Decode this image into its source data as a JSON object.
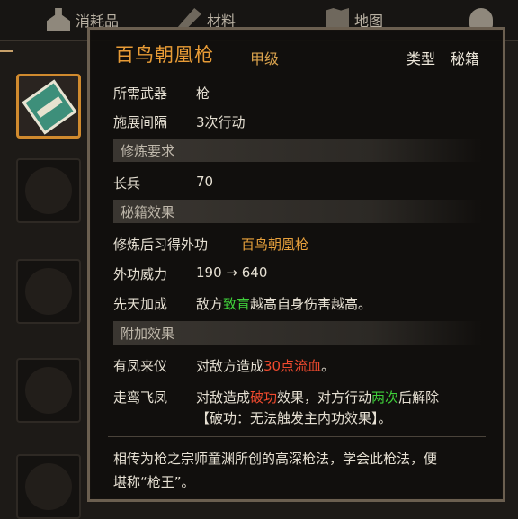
{
  "tabs": [
    {
      "label": "消耗品",
      "icon": "potion-icon"
    },
    {
      "label": "材料",
      "icon": "tools-icon"
    },
    {
      "label": "地图",
      "icon": "map-icon"
    },
    {
      "label": "",
      "icon": "lightbulb-icon"
    }
  ],
  "tooltip": {
    "title": "百鸟朝凰枪",
    "grade": "甲级",
    "type_label": "类型",
    "type_value": "秘籍",
    "weapon_label": "所需武器",
    "weapon_value": "枪",
    "interval_label": "施展间隔",
    "interval_value": "3次行动",
    "req_header": "修炼要求",
    "req_label": "长兵",
    "req_value": "70",
    "effect_header": "秘籍效果",
    "learn_label": "修炼后习得外功",
    "learn_value": "百鸟朝凰枪",
    "power_label": "外功威力",
    "power_value": "190 → 640",
    "innate_label": "先天加成",
    "innate_pre": "敌方",
    "innate_hl": "致盲",
    "innate_post": "越高自身伤害越高。",
    "extra_header": "附加效果",
    "e1_label": "有凤来仪",
    "e1_pre": "对敌方造成",
    "e1_hl": "30点流血",
    "e1_post": "。",
    "e2_label": "走鸾飞凤",
    "e2_pre": "对敌造成",
    "e2_hl1": "破功",
    "e2_mid": "效果，对方行动",
    "e2_hl2": "两次",
    "e2_post": "后解除",
    "e2_line2": "【破功：无法触发主内功效果】。",
    "desc_line1": "相传为枪之宗师童渊所创的高深枪法，学会此枪法，便",
    "desc_line2": "堪称“枪王”。"
  },
  "colors": {
    "accent_orange": "#e8a13c",
    "highlight_green": "#3fcf3a",
    "highlight_red": "#f04a2e",
    "selected_border": "#d08a2e"
  }
}
